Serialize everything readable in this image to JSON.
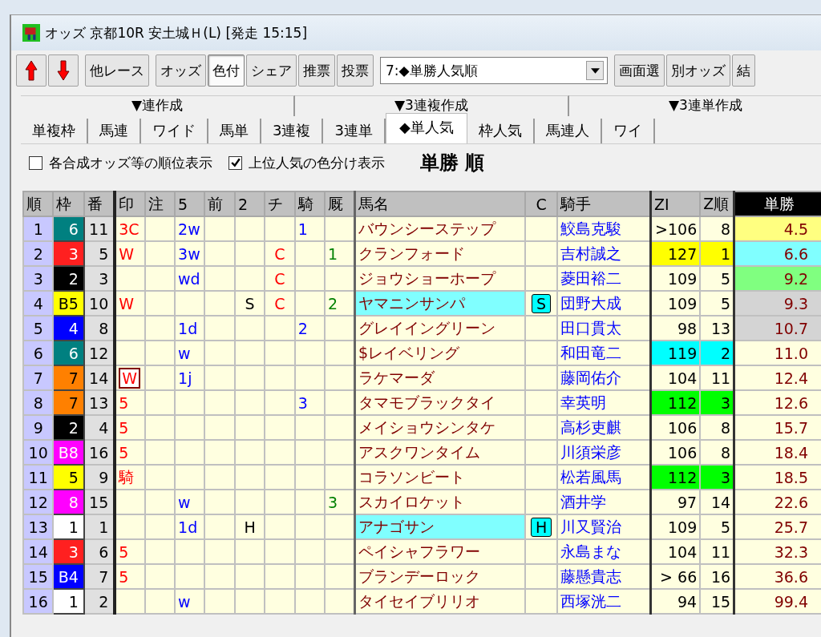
{
  "window": {
    "title": "オッズ 京都10R 安土城Ｈ(L) [発走 15:15]"
  },
  "toolbar": {
    "groups": [
      [
        {
          "label": "他レース",
          "pressed": false
        }
      ],
      [
        {
          "label": "オッズ",
          "pressed": false
        },
        {
          "label": "色付",
          "pressed": true
        },
        {
          "label": "シェア",
          "pressed": false
        },
        {
          "label": "推票",
          "pressed": false
        },
        {
          "label": "投票",
          "pressed": false
        }
      ]
    ],
    "dropdown": {
      "value": "7:◆単勝人気順"
    },
    "right_buttons": [
      {
        "label": "画面選",
        "pressed": false
      },
      {
        "label": "別オッズ",
        "pressed": false
      },
      {
        "label": "結",
        "pressed": false
      }
    ]
  },
  "group_tabs": [
    {
      "label": "▼連作成"
    },
    {
      "label": "▼3連複作成"
    },
    {
      "label": "▼3連単作成"
    }
  ],
  "tabs": [
    {
      "label": "単複枠",
      "selected": false
    },
    {
      "label": "馬連",
      "selected": false
    },
    {
      "label": "ワイド",
      "selected": false
    },
    {
      "label": "馬単",
      "selected": false
    },
    {
      "label": "3連複",
      "selected": false
    },
    {
      "label": "3連単",
      "selected": false
    },
    {
      "label": "◆単人気",
      "selected": true
    },
    {
      "label": "枠人気",
      "selected": false
    },
    {
      "label": "馬連人",
      "selected": false
    },
    {
      "label": "ワイ",
      "selected": false
    }
  ],
  "options": [
    {
      "label": "各合成オッズ等の順位表示",
      "checked": false
    },
    {
      "label": "上位人気の色分け表示",
      "checked": true
    }
  ],
  "heading": "単勝 順",
  "table": {
    "columns": [
      "順",
      "枠",
      "番",
      "印",
      "注",
      "5",
      "前",
      "2",
      "チ",
      "騎",
      "厩",
      "馬名",
      "C",
      "騎手",
      "ZI",
      "Z順",
      "単勝"
    ],
    "rows": [
      {
        "rank": "1",
        "waku": {
          "text": "6",
          "color": "#008080"
        },
        "num": "11",
        "mark": "3C",
        "five": "2w",
        "ki": "1",
        "name": "バウンシーステップ",
        "highlighted": false,
        "jockey": "鮫島克駿",
        "zi": {
          "text": ">106"
        },
        "zrank": {
          "text": "8"
        },
        "odds": {
          "text": "4.5",
          "color": "#ffff80"
        }
      },
      {
        "rank": "2",
        "waku": {
          "text": "3",
          "color": "#ff2020"
        },
        "num": "5",
        "mark": "W",
        "five": "3w",
        "chi": "C",
        "kyu": "1",
        "name": "クランフォード",
        "highlighted": false,
        "jockey": "吉村誠之",
        "zi": {
          "text": "127",
          "color": "#ffff00"
        },
        "zrank": {
          "text": "1",
          "color": "#ffff00"
        },
        "odds": {
          "text": "6.6",
          "color": "#80ffff"
        }
      },
      {
        "rank": "3",
        "waku": {
          "text": "2",
          "color": "#000000"
        },
        "num": "3",
        "five": "wd",
        "chi": "C",
        "name": "ジョウショーホープ",
        "highlighted": false,
        "jockey": "菱田裕二",
        "zi": {
          "text": "109"
        },
        "zrank": {
          "text": "5"
        },
        "odds": {
          "text": "9.2",
          "color": "#80ff80"
        }
      },
      {
        "rank": "4",
        "waku": {
          "text": "B5",
          "color": "#ffff00"
        },
        "num": "10",
        "mark": "W",
        "two": "S",
        "chi": "C",
        "kyu": "2",
        "name": "ヤマニンサンパ",
        "highlighted": true,
        "c": "S",
        "jockey": "団野大成",
        "zi": {
          "text": "109"
        },
        "zrank": {
          "text": "5"
        },
        "odds": {
          "text": "9.3",
          "color": "#d4d4d4"
        }
      },
      {
        "rank": "5",
        "waku": {
          "text": "4",
          "color": "#0000ff"
        },
        "num": "8",
        "five": "1d",
        "ki": "2",
        "name": "グレイイングリーン",
        "highlighted": false,
        "jockey": "田口貫太",
        "zi": {
          "text": "98"
        },
        "zrank": {
          "text": "13"
        },
        "odds": {
          "text": "10.7",
          "color": "#d4d4d4"
        }
      },
      {
        "rank": "6",
        "waku": {
          "text": "6",
          "color": "#008080"
        },
        "num": "12",
        "five": "w",
        "name": "$レイベリング",
        "highlighted": false,
        "jockey": "和田竜二",
        "zi": {
          "text": "119",
          "color": "#00ffff"
        },
        "zrank": {
          "text": "2",
          "color": "#00ffff"
        },
        "odds": {
          "text": "11.0"
        }
      },
      {
        "rank": "7",
        "waku": {
          "text": "7",
          "color": "#ff8000"
        },
        "num": "14",
        "mark": "W",
        "mark_boxed": true,
        "five": "1j",
        "name": "ラケマーダ",
        "highlighted": false,
        "jockey": "藤岡佑介",
        "zi": {
          "text": "104"
        },
        "zrank": {
          "text": "11"
        },
        "odds": {
          "text": "12.4"
        }
      },
      {
        "rank": "8",
        "waku": {
          "text": "7",
          "color": "#ff8000"
        },
        "num": "13",
        "mark": "5",
        "ki": "3",
        "name": "タマモブラックタイ",
        "highlighted": false,
        "jockey": "幸英明",
        "zi": {
          "text": "112",
          "color": "#00ff00"
        },
        "zrank": {
          "text": "3",
          "color": "#00ff00"
        },
        "odds": {
          "text": "12.6"
        }
      },
      {
        "rank": "9",
        "waku": {
          "text": "2",
          "color": "#000000"
        },
        "num": "4",
        "mark": "5",
        "name": "メイショウシンタケ",
        "highlighted": false,
        "jockey": "高杉吏麒",
        "zi": {
          "text": "106"
        },
        "zrank": {
          "text": "8"
        },
        "odds": {
          "text": "15.7"
        }
      },
      {
        "rank": "10",
        "waku": {
          "text": "B8",
          "color": "#ff00ff"
        },
        "num": "16",
        "mark": "5",
        "name": "アスクワンタイム",
        "highlighted": false,
        "jockey": "川須栄彦",
        "zi": {
          "text": "106"
        },
        "zrank": {
          "text": "8"
        },
        "odds": {
          "text": "18.4"
        }
      },
      {
        "rank": "11",
        "waku": {
          "text": "5",
          "color": "#ffff00"
        },
        "num": "9",
        "mark": "騎",
        "name": "コラソンビート",
        "highlighted": false,
        "jockey": "松若風馬",
        "zi": {
          "text": "112",
          "color": "#00ff00"
        },
        "zrank": {
          "text": "3",
          "color": "#00ff00"
        },
        "odds": {
          "text": "18.5"
        }
      },
      {
        "rank": "12",
        "waku": {
          "text": "8",
          "color": "#ff00ff"
        },
        "num": "15",
        "five": "w",
        "kyu": "3",
        "name": "スカイロケット",
        "highlighted": false,
        "jockey": "酒井学",
        "zi": {
          "text": "97"
        },
        "zrank": {
          "text": "14"
        },
        "odds": {
          "text": "22.6"
        }
      },
      {
        "rank": "13",
        "waku": {
          "text": "1",
          "color": "#ffffff"
        },
        "num": "1",
        "five": "1d",
        "two": "H",
        "name": "アナゴサン",
        "highlighted": true,
        "c": "H",
        "jockey": "川又賢治",
        "zi": {
          "text": "109"
        },
        "zrank": {
          "text": "5"
        },
        "odds": {
          "text": "25.7"
        }
      },
      {
        "rank": "14",
        "waku": {
          "text": "3",
          "color": "#ff2020"
        },
        "num": "6",
        "mark": "5",
        "name": "ペイシャフラワー",
        "highlighted": false,
        "jockey": "永島まな",
        "zi": {
          "text": "104"
        },
        "zrank": {
          "text": "11"
        },
        "odds": {
          "text": "32.3"
        }
      },
      {
        "rank": "15",
        "waku": {
          "text": "B4",
          "color": "#0000ff"
        },
        "num": "7",
        "mark": "5",
        "name": "ブランデーロック",
        "highlighted": false,
        "jockey": "藤懸貴志",
        "zi": {
          "text": "> 66"
        },
        "zrank": {
          "text": "16"
        },
        "odds": {
          "text": "36.6"
        }
      },
      {
        "rank": "16",
        "waku": {
          "text": "1",
          "color": "#ffffff"
        },
        "num": "2",
        "five": "w",
        "name": "タイセイブリリオ",
        "highlighted": false,
        "jockey": "西塚洸二",
        "zi": {
          "text": "94"
        },
        "zrank": {
          "text": "15"
        },
        "odds": {
          "text": "99.4"
        }
      }
    ]
  }
}
